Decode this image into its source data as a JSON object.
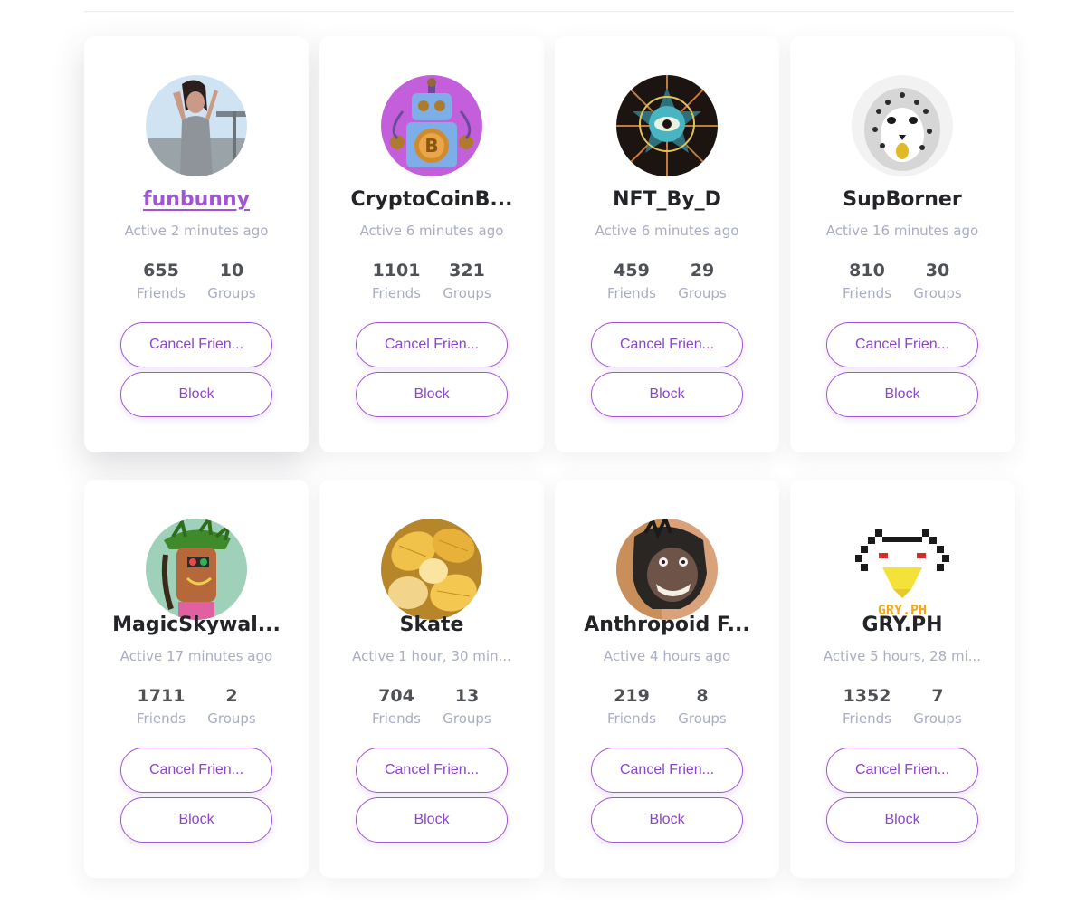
{
  "members": [
    {
      "name": "funbunny",
      "active": "Active 2 minutes ago",
      "friends": "655",
      "groups": "10",
      "cancel_label": "Cancel Frien...",
      "block_label": "Block"
    },
    {
      "name": "CryptoCoinB...",
      "active": "Active 6 minutes ago",
      "friends": "1101",
      "groups": "321",
      "cancel_label": "Cancel Frien...",
      "block_label": "Block"
    },
    {
      "name": "NFT_By_D",
      "active": "Active 6 minutes ago",
      "friends": "459",
      "groups": "29",
      "cancel_label": "Cancel Frien...",
      "block_label": "Block"
    },
    {
      "name": "SupBorner",
      "active": "Active 16 minutes ago",
      "friends": "810",
      "groups": "30",
      "cancel_label": "Cancel Frien...",
      "block_label": "Block"
    },
    {
      "name": "MagicSkywal...",
      "active": "Active 17 minutes ago",
      "friends": "1711",
      "groups": "2",
      "cancel_label": "Cancel Frien...",
      "block_label": "Block"
    },
    {
      "name": "Skate",
      "active": "Active 1 hour, 30 min...",
      "friends": "704",
      "groups": "13",
      "cancel_label": "Cancel Frien...",
      "block_label": "Block"
    },
    {
      "name": "Anthropoid F...",
      "active": "Active 4 hours ago",
      "friends": "219",
      "groups": "8",
      "cancel_label": "Cancel Frien...",
      "block_label": "Block"
    },
    {
      "name": "GRY.PH",
      "active": "Active 5 hours, 28 mi...",
      "friends": "1352",
      "groups": "7",
      "cancel_label": "Cancel Frien...",
      "block_label": "Block",
      "avatar_text": "GRY.PH"
    }
  ],
  "labels": {
    "friends": "Friends",
    "groups": "Groups"
  },
  "colors": {
    "accent": "#a054d6",
    "muted": "#a9adc4",
    "name": "#222428"
  }
}
